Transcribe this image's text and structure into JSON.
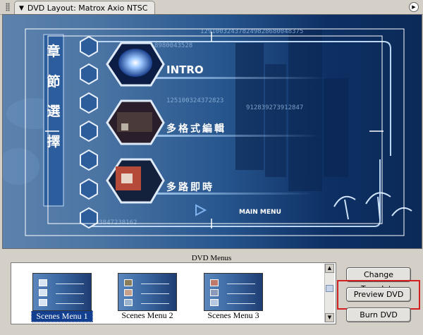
{
  "window": {
    "title": "DVD Layout: Matrox Axio NTSC",
    "collapse_glyph": "▼",
    "menu_glyph": "▶"
  },
  "preview": {
    "vertical_title": [
      "章",
      "節",
      "選",
      "擇"
    ],
    "items": [
      "INTRO",
      "多格式編輯",
      "多路即時"
    ],
    "main_menu_label": "MAIN MENU",
    "digit_strings": [
      "129100324378249828680048375",
      "8980043528",
      "125100324372823",
      "912839273912847",
      "1293847238162"
    ]
  },
  "menus_panel": {
    "label": "DVD Menus",
    "thumbnails": [
      {
        "label": "Scenes Menu 1",
        "selected": true
      },
      {
        "label": "Scenes Menu 2",
        "selected": false
      },
      {
        "label": "Scenes Menu 3",
        "selected": false
      }
    ],
    "scroll_up_glyph": "▲",
    "scroll_down_glyph": "▼"
  },
  "buttons": {
    "change_template": "Change Template",
    "preview_dvd": "Preview DVD",
    "burn_dvd": "Burn DVD"
  },
  "colors": {
    "highlight_border": "#d22020",
    "selection": "#123f8f"
  }
}
